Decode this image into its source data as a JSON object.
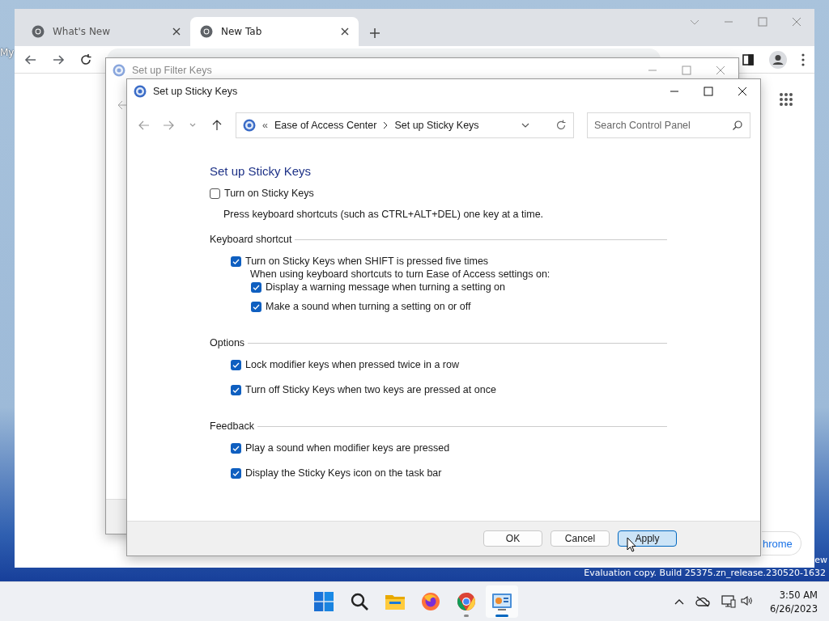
{
  "desktop": {
    "icon_label": "My",
    "watermark": [
      "ew",
      "Evaluation copy. Build 25375.zn_release.230520-1632"
    ]
  },
  "browser": {
    "tabs": [
      {
        "label": "What's New",
        "selected": false
      },
      {
        "label": "New Tab",
        "selected": true
      }
    ],
    "customize_button": "hrome"
  },
  "filter_window": {
    "title": "Set up Filter Keys"
  },
  "sticky_window": {
    "title": "Set up Sticky Keys",
    "breadcrumb_prefix": "«",
    "breadcrumb": [
      "Ease of Access Center",
      "Set up Sticky Keys"
    ],
    "search": {
      "placeholder": "Search Control Panel"
    },
    "heading": "Set up Sticky Keys",
    "option": {
      "label": "Turn on Sticky Keys",
      "checked": false
    },
    "description": "Press keyboard shortcuts (such as CTRL+ALT+DEL) one key at a time.",
    "sections": [
      {
        "title": "Keyboard shortcut",
        "items": [
          {
            "label": "Turn on Sticky Keys when SHIFT is pressed five times",
            "checked": true,
            "note": "When using keyboard shortcuts to turn Ease of Access settings on:",
            "children": [
              {
                "label": "Display a warning message when turning a setting on",
                "checked": true
              },
              {
                "label": "Make a sound when turning a setting on or off",
                "checked": true
              }
            ]
          }
        ]
      },
      {
        "title": "Options",
        "items": [
          {
            "label": "Lock modifier keys when pressed twice in a row",
            "checked": true
          },
          {
            "label": "Turn off Sticky Keys when two keys are pressed at once",
            "checked": true
          }
        ]
      },
      {
        "title": "Feedback",
        "items": [
          {
            "label": "Play a sound when modifier keys are pressed",
            "checked": true
          },
          {
            "label": "Display the Sticky Keys icon on the task bar",
            "checked": true
          }
        ]
      }
    ],
    "buttons": [
      {
        "label": "OK",
        "hovered": false
      },
      {
        "label": "Cancel",
        "hovered": false
      },
      {
        "label": "Apply",
        "hovered": true
      }
    ]
  },
  "taskbar": {
    "apps": [
      {
        "kind": "start",
        "running": false,
        "active": false
      },
      {
        "kind": "search",
        "running": false,
        "active": false
      },
      {
        "kind": "explorer",
        "running": false,
        "active": false
      },
      {
        "kind": "firefox",
        "running": false,
        "active": false
      },
      {
        "kind": "chrome",
        "running": true,
        "active": false
      },
      {
        "kind": "control-panel",
        "running": true,
        "active": true
      }
    ],
    "time": "3:50 AM",
    "date": "6/26/2023"
  }
}
